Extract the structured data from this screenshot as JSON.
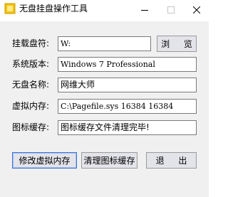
{
  "window": {
    "title": "无盘挂盘操作工具",
    "icons": {
      "app": "app-icon",
      "minimize": "minimize-icon",
      "maximize": "maximize-icon",
      "close": "close-icon"
    }
  },
  "form": {
    "drive": {
      "label": "挂载盘符:",
      "value": "W:"
    },
    "system": {
      "label": "系统版本:",
      "value": "Windows 7 Professional"
    },
    "diskless": {
      "label": "无盘名称:",
      "value": "网维大师"
    },
    "virtual_memory": {
      "label": "虚拟内存:",
      "value": "C:\\Pagefile.sys 16384 16384"
    },
    "icon_cache": {
      "label": "图标缓存:",
      "value": "图标缓存文件清理完毕!"
    }
  },
  "buttons": {
    "browse": "浏 览",
    "modify_vm": "修改虚拟内存",
    "clean_cache": "清理图标缓存",
    "exit": "退 出"
  },
  "colors": {
    "client_bg": "#f0f0f0",
    "button_bg": "#e3e3ea",
    "focus_border": "#3c6fd6",
    "app_icon": "#f5c400"
  }
}
